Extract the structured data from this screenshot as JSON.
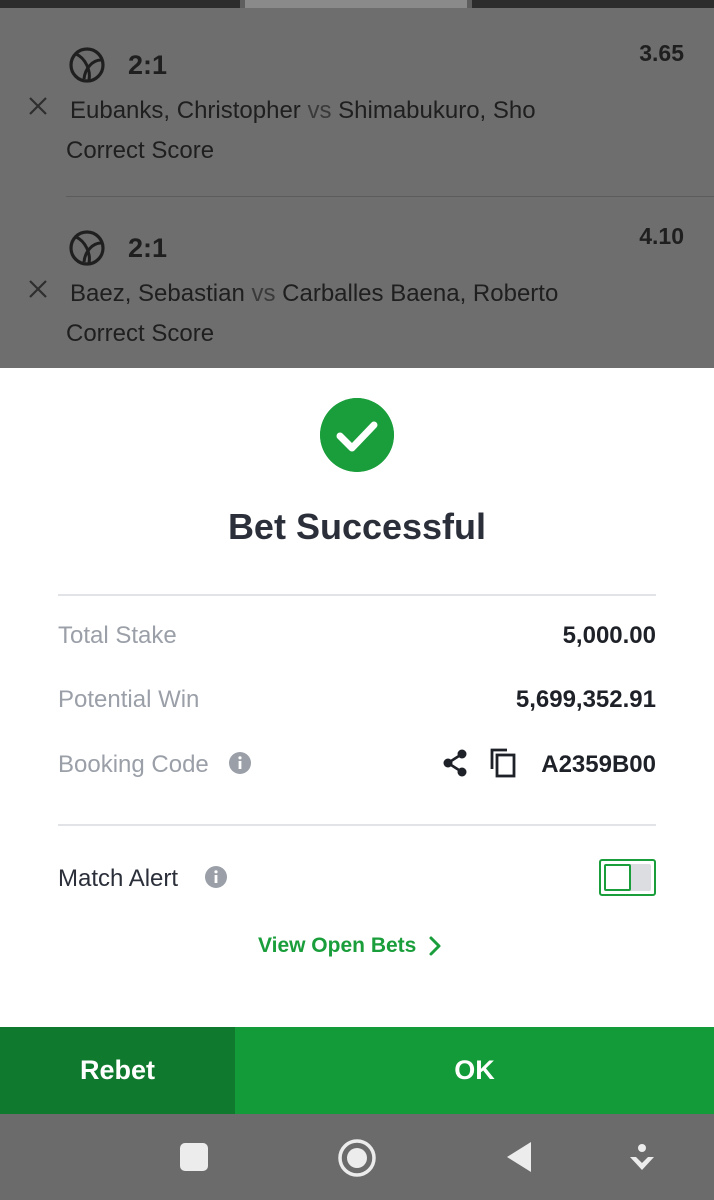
{
  "bet_slip": {
    "selections": [
      {
        "pick": "2:1",
        "odds": "3.65",
        "home": "Eubanks, Christopher",
        "vs": "vs",
        "away": "Shimabukuro, Sho",
        "market": "Correct Score"
      },
      {
        "pick": "2:1",
        "odds": "4.10",
        "home": "Baez, Sebastian",
        "vs": "vs",
        "away": "Carballes Baena, Roberto",
        "market": "Correct Score"
      }
    ],
    "sport_icon": "tennis-ball-icon",
    "remove_icon": "close-icon"
  },
  "modal": {
    "title": "Bet Successful",
    "status_icon": "check-circle-icon",
    "total_stake_label": "Total Stake",
    "total_stake_value": "5,000.00",
    "potential_win_label": "Potential Win",
    "potential_win_value": "5,699,352.91",
    "booking_code_label": "Booking Code",
    "booking_code_value": "A2359B00",
    "match_alert_label": "Match Alert",
    "match_alert_enabled": false,
    "view_open_bets": "View Open Bets"
  },
  "actions": {
    "rebet": "Rebet",
    "ok": "OK"
  },
  "colors": {
    "brand_green": "#129b38",
    "dark_green": "#0f7a2e",
    "title_text": "#2b2f3a",
    "muted_text": "#9a9fa8"
  },
  "system_nav": {
    "buttons": [
      "recents-icon",
      "home-icon",
      "back-icon",
      "notification-pull-icon"
    ]
  }
}
